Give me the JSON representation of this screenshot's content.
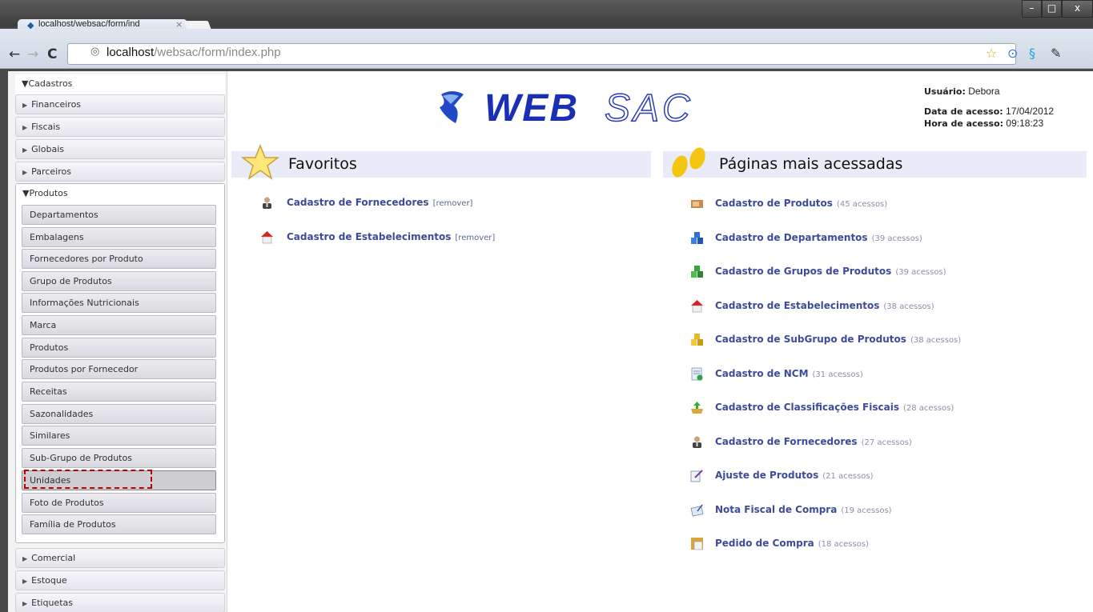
{
  "browser": {
    "tab_title": "localhost/websac/form/ind",
    "tab_close": "×",
    "url_host": "localhost",
    "url_path": "/websac/form/index.php",
    "window_controls": {
      "minimize": "–",
      "maximize": "□",
      "close": "x"
    },
    "icons": [
      "back-icon",
      "forward-icon",
      "reload-icon",
      "star-icon",
      "extension-icon",
      "skype-icon",
      "wrench-icon"
    ]
  },
  "sidebar": {
    "top_groups": [
      {
        "label": "Cadastros",
        "expanded": true
      },
      {
        "label": "Financeiros",
        "expanded": false
      },
      {
        "label": "Fiscais",
        "expanded": false
      },
      {
        "label": "Globais",
        "expanded": false
      },
      {
        "label": "Parceiros",
        "expanded": false
      },
      {
        "label": "Produtos",
        "expanded": true
      }
    ],
    "produtos_items": [
      "Departamentos",
      "Embalagens",
      "Fornecedores por Produto",
      "Grupo de Produtos",
      "Informações Nutricionais",
      "Marca",
      "Produtos",
      "Produtos por Fornecedor",
      "Receitas",
      "Sazonalidades",
      "Similares",
      "Sub-Grupo de Produtos",
      "Unidades",
      "Foto de Produtos",
      "Família de Produtos"
    ],
    "selected_item": "Unidades",
    "bottom_groups": [
      "Comercial",
      "Estoque",
      "Etiquetas"
    ]
  },
  "header": {
    "logo_part1": "WEB",
    "logo_part2": "SAC",
    "user_label": "Usuário:",
    "user_value": "Debora",
    "date_label": "Data de acesso:",
    "date_value": "17/04/2012",
    "time_label": "Hora de acesso:",
    "time_value": "09:18:23"
  },
  "favoritos": {
    "title": "Favoritos",
    "items": [
      {
        "label": "Cadastro de Fornecedores",
        "action": "[remover]",
        "icon": "supplier-person-icon"
      },
      {
        "label": "Cadastro de Estabelecimentos",
        "action": "[remover]",
        "icon": "house-icon"
      }
    ]
  },
  "mais_acessadas": {
    "title": "Páginas mais acessadas",
    "items": [
      {
        "label": "Cadastro de Produtos",
        "count": "(45 acessos)",
        "icon": "product-box-icon"
      },
      {
        "label": "Cadastro de Departamentos",
        "count": "(39 acessos)",
        "icon": "blue-cubes-icon"
      },
      {
        "label": "Cadastro de Grupos de Produtos",
        "count": "(39 acessos)",
        "icon": "green-cubes-icon"
      },
      {
        "label": "Cadastro de Estabelecimentos",
        "count": "(38 acessos)",
        "icon": "house-icon"
      },
      {
        "label": "Cadastro de SubGrupo de Produtos",
        "count": "(38 acessos)",
        "icon": "yellow-cubes-icon"
      },
      {
        "label": "Cadastro de NCM",
        "count": "(31 acessos)",
        "icon": "document-check-icon"
      },
      {
        "label": "Cadastro de Classificações Fiscais",
        "count": "(28 acessos)",
        "icon": "tray-arrow-icon"
      },
      {
        "label": "Cadastro de Fornecedores",
        "count": "(27 acessos)",
        "icon": "supplier-person-icon"
      },
      {
        "label": "Ajuste de Produtos",
        "count": "(21 acessos)",
        "icon": "edit-note-icon"
      },
      {
        "label": "Nota Fiscal de Compra",
        "count": "(19 acessos)",
        "icon": "invoice-pen-icon"
      },
      {
        "label": "Pedido de Compra",
        "count": "(18 acessos)",
        "icon": "order-folder-icon"
      }
    ]
  },
  "colors": {
    "link": "#3d4b9a",
    "section_bar": "#e9ebf8",
    "highlight_dashed": "#c00000",
    "logo_blue": "#1b2fb5"
  }
}
